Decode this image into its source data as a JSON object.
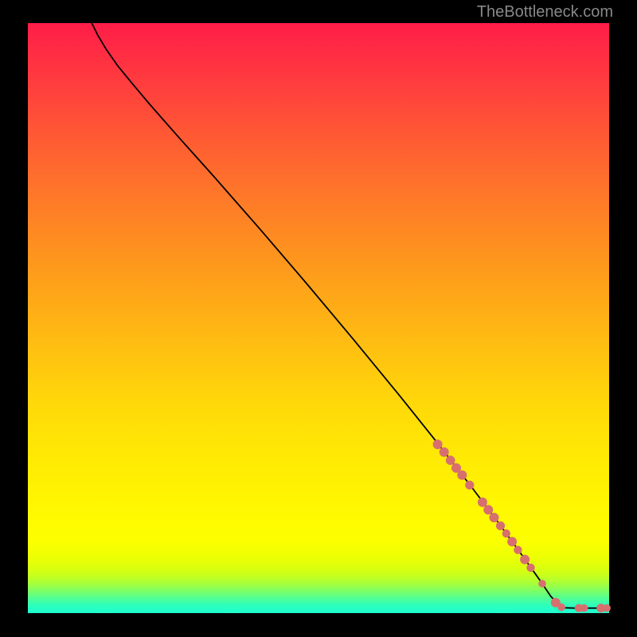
{
  "attribution": "TheBottleneck.com",
  "colors": {
    "frame": "#000000",
    "curve": "#000000",
    "marker": "#d76f6f",
    "top_gradient": "#ff1d48",
    "bottom_gradient": "#20ffcd"
  },
  "chart_data": {
    "type": "line",
    "title": "",
    "xlabel": "",
    "ylabel": "",
    "xlim": [
      0,
      100
    ],
    "ylim": [
      0,
      100
    ],
    "curve": [
      {
        "x": 11,
        "y": 100
      },
      {
        "x": 12,
        "y": 98
      },
      {
        "x": 13.5,
        "y": 95.5
      },
      {
        "x": 15.5,
        "y": 92.7
      },
      {
        "x": 18,
        "y": 89.7
      },
      {
        "x": 21,
        "y": 86.2
      },
      {
        "x": 26,
        "y": 80.6
      },
      {
        "x": 32,
        "y": 74
      },
      {
        "x": 40,
        "y": 65
      },
      {
        "x": 48,
        "y": 55.8
      },
      {
        "x": 56,
        "y": 46.4
      },
      {
        "x": 64,
        "y": 36.8
      },
      {
        "x": 70,
        "y": 29.4
      },
      {
        "x": 76,
        "y": 21.8
      },
      {
        "x": 80,
        "y": 16.6
      },
      {
        "x": 84,
        "y": 11.2
      },
      {
        "x": 88,
        "y": 5.7
      },
      {
        "x": 90,
        "y": 2.8
      },
      {
        "x": 91.5,
        "y": 1.3
      },
      {
        "x": 92.3,
        "y": 0.9
      },
      {
        "x": 94,
        "y": 0.85
      },
      {
        "x": 96,
        "y": 0.85
      },
      {
        "x": 98,
        "y": 0.85
      },
      {
        "x": 100,
        "y": 0.85
      }
    ],
    "markers": [
      {
        "x": 70.5,
        "y": 28.6,
        "r": 6.0
      },
      {
        "x": 71.6,
        "y": 27.3,
        "r": 6.0
      },
      {
        "x": 72.7,
        "y": 25.9,
        "r": 5.8
      },
      {
        "x": 73.7,
        "y": 24.6,
        "r": 6.0
      },
      {
        "x": 74.7,
        "y": 23.4,
        "r": 6.0
      },
      {
        "x": 76.0,
        "y": 21.7,
        "r": 5.6
      },
      {
        "x": 78.2,
        "y": 18.8,
        "r": 6.0
      },
      {
        "x": 79.2,
        "y": 17.5,
        "r": 6.0
      },
      {
        "x": 80.2,
        "y": 16.2,
        "r": 6.0
      },
      {
        "x": 81.3,
        "y": 14.8,
        "r": 5.6
      },
      {
        "x": 82.3,
        "y": 13.5,
        "r": 5.2
      },
      {
        "x": 83.3,
        "y": 12.1,
        "r": 6.0
      },
      {
        "x": 84.3,
        "y": 10.7,
        "r": 5.2
      },
      {
        "x": 85.5,
        "y": 9.1,
        "r": 6.0
      },
      {
        "x": 86.5,
        "y": 7.7,
        "r": 5.2
      },
      {
        "x": 88.5,
        "y": 5.0,
        "r": 4.8
      },
      {
        "x": 90.8,
        "y": 1.8,
        "r": 6.0
      },
      {
        "x": 91.8,
        "y": 1.0,
        "r": 4.8
      },
      {
        "x": 94.8,
        "y": 0.85,
        "r": 5.2
      },
      {
        "x": 95.7,
        "y": 0.85,
        "r": 4.8
      },
      {
        "x": 98.6,
        "y": 0.85,
        "r": 5.6
      },
      {
        "x": 99.6,
        "y": 0.85,
        "r": 4.8
      }
    ]
  }
}
